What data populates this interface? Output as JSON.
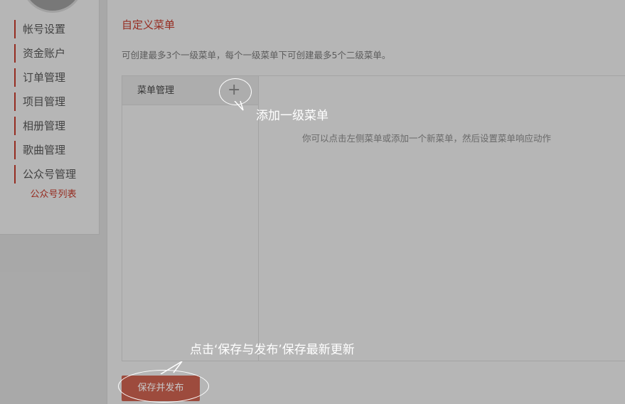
{
  "sidebar": {
    "items": [
      {
        "label": "帐号设置"
      },
      {
        "label": "资金账户"
      },
      {
        "label": "订单管理"
      },
      {
        "label": "项目管理"
      },
      {
        "label": "相册管理"
      },
      {
        "label": "歌曲管理"
      },
      {
        "label": "公众号管理"
      }
    ],
    "sub_item": "公众号列表",
    "accent_color": "#c0392b"
  },
  "main": {
    "title": "自定义菜单",
    "hint": "可创建最多3个一级菜单，每个一级菜单下可创建最多5个二级菜单。",
    "menu_item_label": "菜单管理",
    "add_icon": "plus-icon",
    "empty_tip": "你可以点击左侧菜单或添加一个新菜单，然后设置菜单响应动作",
    "publish_label": "保存并发布"
  },
  "guide": {
    "add_menu_tip": "添加一级菜单",
    "publish_tip": "点击‘保存与发布’保存最新更新"
  }
}
